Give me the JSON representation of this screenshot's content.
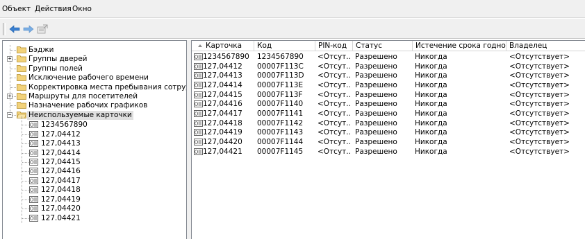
{
  "menubar": {
    "items": [
      "Объект",
      "Действия",
      "Окно"
    ]
  },
  "toolbar": {
    "buttons": [
      "back-arrow-icon",
      "forward-arrow-icon",
      "export-list-icon"
    ]
  },
  "tree": {
    "folders": [
      {
        "label": "Бэджи",
        "expandable": false
      },
      {
        "label": "Группы дверей",
        "expandable": true
      },
      {
        "label": "Группы полей",
        "expandable": false
      },
      {
        "label": "Исключение рабочего времени",
        "expandable": false
      },
      {
        "label": "Корректировка места пребывания сотрудника",
        "expandable": false
      },
      {
        "label": "Маршруты для посетителей",
        "expandable": true
      },
      {
        "label": "Назначение рабочих графиков",
        "expandable": false
      },
      {
        "label": "Неиспользуемые карточки",
        "expandable": true,
        "expanded": true,
        "selected": true
      }
    ],
    "expander_collapsed": "+",
    "expander_expanded": "−",
    "cards": [
      "1234567890",
      "127,04412",
      "127,04413",
      "127,04414",
      "127,04415",
      "127,04416",
      "127,04417",
      "127,04418",
      "127,04419",
      "127,04420",
      "127.04421"
    ]
  },
  "list": {
    "columns": [
      "Карточка",
      "Код",
      "PIN-код",
      "Статус",
      "Истечение срока годности",
      "Владелец"
    ],
    "rows": [
      [
        "1234567890",
        "1234567890",
        "<Отсут...",
        "Разрешено",
        "Никогда",
        "<Отсутствует>"
      ],
      [
        "127,04412",
        "00007F113C",
        "<Отсут...",
        "Разрешено",
        "Никогда",
        "<Отсутствует>"
      ],
      [
        "127,04413",
        "00007F113D",
        "<Отсут...",
        "Разрешено",
        "Никогда",
        "<Отсутствует>"
      ],
      [
        "127,04414",
        "00007F113E",
        "<Отсут...",
        "Разрешено",
        "Никогда",
        "<Отсутствует>"
      ],
      [
        "127,04415",
        "00007F113F",
        "<Отсут...",
        "Разрешено",
        "Никогда",
        "<Отсутствует>"
      ],
      [
        "127,04416",
        "00007F1140",
        "<Отсут...",
        "Разрешено",
        "Никогда",
        "<Отсутствует>"
      ],
      [
        "127,04417",
        "00007F1141",
        "<Отсут...",
        "Разрешено",
        "Никогда",
        "<Отсутствует>"
      ],
      [
        "127,04418",
        "00007F1142",
        "<Отсут...",
        "Разрешено",
        "Никогда",
        "<Отсутствует>"
      ],
      [
        "127,04419",
        "00007F1143",
        "<Отсут...",
        "Разрешено",
        "Никогда",
        "<Отсутствует>"
      ],
      [
        "127,04420",
        "00007F1144",
        "<Отсут...",
        "Разрешено",
        "Никогда",
        "<Отсутствует>"
      ],
      [
        "127,04421",
        "00007F1145",
        "<Отсут...",
        "Разрешено",
        "Никогда",
        "<Отсутствует>"
      ]
    ]
  },
  "colors": {
    "folder": "#f2d27a",
    "folder_edge": "#b08a2a",
    "arrow": "#3a7fd0",
    "selection": "#e0e0e0"
  }
}
